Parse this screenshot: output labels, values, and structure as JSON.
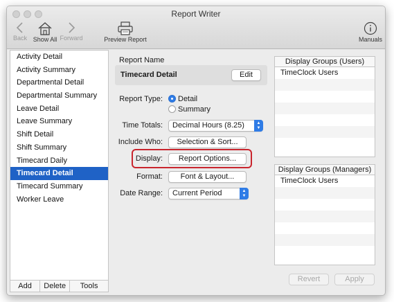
{
  "window": {
    "title": "Report Writer"
  },
  "toolbar": {
    "back": "Back",
    "show_all": "Show All",
    "forward": "Forward",
    "preview": "Preview Report",
    "manuals": "Manuals"
  },
  "sidebar": {
    "items": [
      "Activity Detail",
      "Activity Summary",
      "Departmental Detail",
      "Departmental Summary",
      "Leave Detail",
      "Leave Summary",
      "Shift Detail",
      "Shift Summary",
      "Timecard Daily",
      "Timecard Detail",
      "Timecard Summary",
      "Worker Leave"
    ],
    "selected_index": 9,
    "footer": {
      "add": "Add",
      "delete": "Delete",
      "tools": "Tools"
    }
  },
  "report": {
    "name_label": "Report Name",
    "name_value": "Timecard Detail",
    "edit": "Edit",
    "type_label": "Report Type:",
    "type_detail": "Detail",
    "type_summary": "Summary",
    "time_totals_label": "Time Totals:",
    "time_totals_value": "Decimal Hours (8.25)",
    "include_who_label": "Include Who:",
    "include_who_button": "Selection & Sort...",
    "display_label": "Display:",
    "display_button": "Report Options...",
    "format_label": "Format:",
    "format_button": "Font & Layout...",
    "date_range_label": "Date Range:",
    "date_range_value": "Current Period"
  },
  "groups": {
    "users_header": "Display Groups (Users)",
    "users_items": [
      "TimeClock Users"
    ],
    "managers_header": "Display Groups (Managers)",
    "managers_items": [
      "TimeClock Users"
    ]
  },
  "actions": {
    "revert": "Revert",
    "apply": "Apply"
  },
  "colors": {
    "selection": "#1f62c6",
    "highlight": "#c9252d",
    "accent": "#2f7ce6"
  }
}
